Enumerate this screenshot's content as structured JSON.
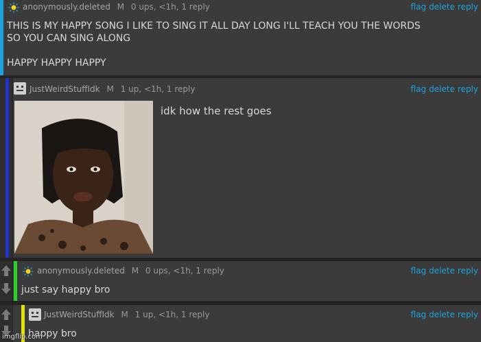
{
  "comments": [
    {
      "username": "anonymously.deleted",
      "badge": "M",
      "stats": "0 ups, <1h, 1 reply",
      "text": "THIS IS MY HAPPY SONG I LIKE TO SING IT ALL DAY LONG I'LL TEACH YOU THE WORDS\nSO YOU CAN SING ALONG\n\nHAPPY HAPPY HAPPY",
      "avatar_icon": "sun-icon",
      "bar_color": "#1fa3dc"
    },
    {
      "username": "JustWeirdStuffIdk",
      "badge": "M",
      "stats": "1 up, <1h, 1 reply",
      "text": "idk how the rest goes",
      "avatar_icon": "robot-icon",
      "bar_color": "#2233c6"
    },
    {
      "username": "anonymously.deleted",
      "badge": "M",
      "stats": "0 ups, <1h, 1 reply",
      "text": "just say happy bro",
      "avatar_icon": "sun-icon",
      "bar_color": "#2bd02b"
    },
    {
      "username": "JustWeirdStuffIdk",
      "badge": "M",
      "stats": "1 up, <1h, 1 reply",
      "text": "happy bro",
      "avatar_icon": "robot-icon",
      "bar_color": "#e6e20c"
    }
  ],
  "actions": {
    "flag": "flag",
    "delete": "delete",
    "reply": "reply"
  },
  "watermark": "imgflip.com"
}
